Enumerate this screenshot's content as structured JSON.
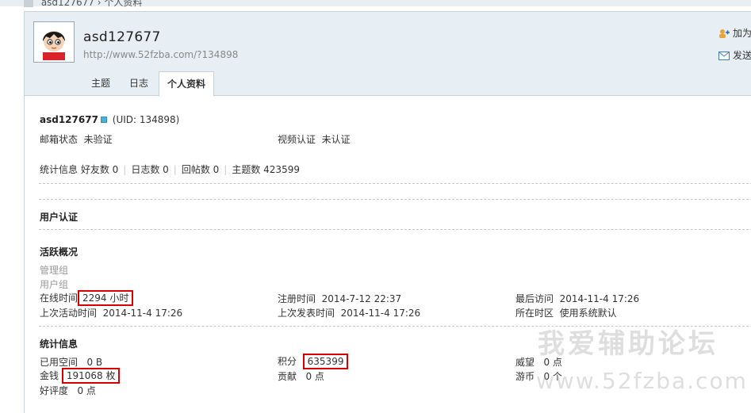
{
  "breadcrumb": {
    "user": "asd127677",
    "sep": "›",
    "page": "个人资料"
  },
  "profile": {
    "username": "asd127677",
    "url": "http://www.52fzba.com/?134898",
    "actions": [
      {
        "label": "加为好友",
        "icon": "add-friend-icon"
      },
      {
        "label": "发送消息",
        "icon": "envelope-icon"
      }
    ]
  },
  "tabs": [
    {
      "label": "主题"
    },
    {
      "label": "日志"
    },
    {
      "label": "个人资料"
    }
  ],
  "info": {
    "name": "asd127677",
    "uid": "(UID: 134898)",
    "email_status_label": "邮箱状态",
    "email_status_value": "未验证",
    "video_auth_label": "视频认证",
    "video_auth_value": "未认证",
    "stats_label": "统计信息",
    "friends": "好友数 0",
    "blogs": "日志数 0",
    "replies": "回帖数 0",
    "topics": "主题数 423599"
  },
  "sections": {
    "user_auth": "用户认证",
    "activity": "活跃概况",
    "statistics": "统计信息"
  },
  "activity": {
    "admin_group": "管理组",
    "user_group": "用户组",
    "online_time_label": "在线时间",
    "online_time_value": "2294 小时",
    "register_label": "注册时间",
    "register_value": "2014-7-12 22:37",
    "last_visit_label": "最后访问",
    "last_visit_value": "2014-11-4 17:26",
    "last_active_label": "上次活动时间",
    "last_active_value": "2014-11-4 17:26",
    "last_post_label": "上次发表时间",
    "last_post_value": "2014-11-4 17:26",
    "timezone_label": "所在时区",
    "timezone_value": "使用系统默认"
  },
  "statistics": {
    "space_label": "已用空间",
    "space_value": "0 B",
    "points_label": "积分",
    "points_value": "635399",
    "prestige_label": "威望",
    "prestige_value": "0 点",
    "money_label": "金钱",
    "money_value": "191068 枚",
    "contribution_label": "贡献",
    "contribution_value": "0 点",
    "coins_label": "游币",
    "coins_value": "0 个",
    "rating_label": "好评度",
    "rating_value": "0 点"
  },
  "watermark": {
    "line1": "我爱辅助论坛",
    "line2": "www.52fzba.com"
  },
  "colors": {
    "header_bg": "#e7eef4",
    "border": "#c7d1da",
    "highlight_box": "#d40000",
    "badge": "#4ab0d9"
  }
}
